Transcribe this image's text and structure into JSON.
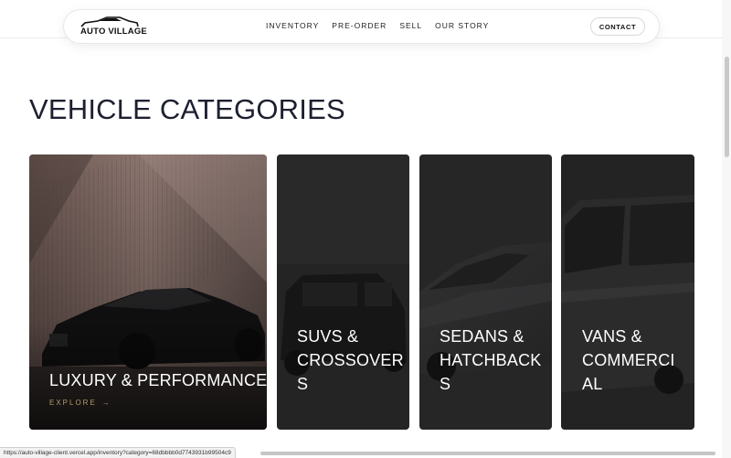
{
  "header": {
    "logo_text": "AUTO VILLAGE",
    "nav": [
      "INVENTORY",
      "PRE-ORDER",
      "SELL",
      "OUR STORY"
    ],
    "contact_label": "CONTACT"
  },
  "section": {
    "title": "VEHICLE CATEGORIES"
  },
  "cards": [
    {
      "label": "LUXURY & PERFORMANCE",
      "cta": "EXPLORE",
      "cta_icon": "arrow-right-icon"
    },
    {
      "label_lines": [
        "SUVS &",
        "CROSSOVER",
        "S"
      ]
    },
    {
      "label_lines": [
        "SEDANS &",
        "HATCHBACK",
        "S"
      ]
    },
    {
      "label_lines": [
        "VANS &",
        "COMMERCI",
        "AL"
      ]
    }
  ],
  "status_bar": {
    "url": "https://auto-village-client.vercel.app/inventory?category=68dbbbb0d7743931b99504c9"
  },
  "colors": {
    "accent_gold": "#b59a6a",
    "title": "#1c2030",
    "card_dark": "#1f1f20"
  }
}
